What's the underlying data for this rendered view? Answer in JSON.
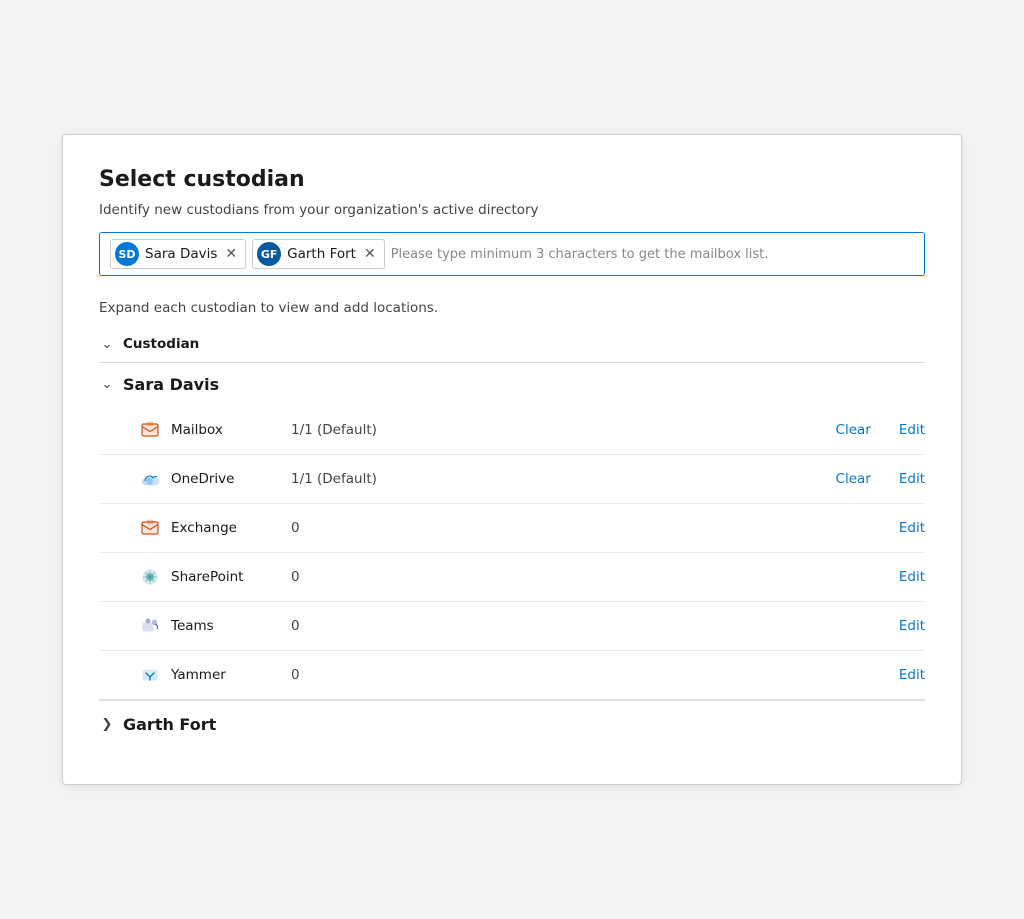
{
  "page": {
    "title": "Select custodian",
    "subtitle": "Identify new custodians from your organization's active directory"
  },
  "search": {
    "placeholder": "Please type minimum 3 characters to get the mailbox list."
  },
  "tags": [
    {
      "id": "sd",
      "initials": "SD",
      "name": "Sara Davis",
      "avatar_class": "avatar-sd"
    },
    {
      "id": "gf",
      "initials": "GF",
      "name": "Garth Fort",
      "avatar_class": "avatar-gf"
    }
  ],
  "expand_label": "Expand each custodian to view and add locations.",
  "column_header": "Custodian",
  "custodians": [
    {
      "name": "Sara Davis",
      "expanded": true,
      "locations": [
        {
          "icon": "📧",
          "name": "Mailbox",
          "value": "1/1 (Default)",
          "has_clear": true,
          "has_edit": true
        },
        {
          "icon": "☁",
          "name": "OneDrive",
          "value": "1/1 (Default)",
          "has_clear": true,
          "has_edit": true
        },
        {
          "icon": "📧",
          "name": "Exchange",
          "value": "0",
          "has_clear": false,
          "has_edit": true
        },
        {
          "icon": "⚙",
          "name": "SharePoint",
          "value": "0",
          "has_clear": false,
          "has_edit": true
        },
        {
          "icon": "👥",
          "name": "Teams",
          "value": "0",
          "has_clear": false,
          "has_edit": true
        },
        {
          "icon": "💬",
          "name": "Yammer",
          "value": "0",
          "has_clear": false,
          "has_edit": true
        }
      ]
    }
  ],
  "garth": {
    "name": "Garth Fort",
    "expanded": false
  },
  "actions": {
    "clear_label": "Clear",
    "edit_label": "Edit"
  }
}
